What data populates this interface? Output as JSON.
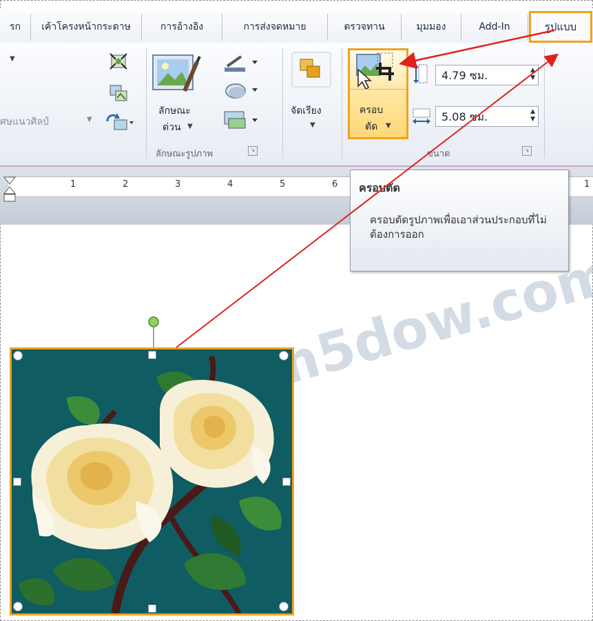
{
  "tabs": [
    {
      "label": "รก"
    },
    {
      "label": "เค้าโครงหน้ากระดาษ"
    },
    {
      "label": "การอ้างอิง"
    },
    {
      "label": "การส่งจดหมาย"
    },
    {
      "label": "ตรวจทาน"
    },
    {
      "label": "มุมมอง"
    },
    {
      "label": "Add-In"
    },
    {
      "label": "รูปแบบ"
    }
  ],
  "ribbon": {
    "artistic_effects_label": "ศษแนวศิลป์",
    "picture_styles": {
      "quick_styles_label_line1": "ลักษณะ",
      "quick_styles_label_line2": "ด่วน",
      "group_label": "ลักษณะรูปภาพ"
    },
    "arrange": {
      "label": "จัดเรียง"
    },
    "size": {
      "crop_label_line1": "ครอบ",
      "crop_label_line2": "ตัด",
      "height_value": "4.79 ซม.",
      "width_value": "5.08 ซม.",
      "group_label": "ขนาด"
    }
  },
  "ruler": {
    "numbers": [
      "1",
      "2",
      "3",
      "4",
      "5",
      "6",
      "1"
    ]
  },
  "tooltip": {
    "title": "ครอบตัด",
    "body": "ครอบตัดรูปภาพเพื่อเอาส่วนประกอบที่ไม่ต้องการออก"
  },
  "watermark": {
    "text": "www.com5dow.com"
  },
  "colors": {
    "highlight": "#f0a21c",
    "arrow": "#e02020",
    "image_background": "#0f5c62"
  }
}
